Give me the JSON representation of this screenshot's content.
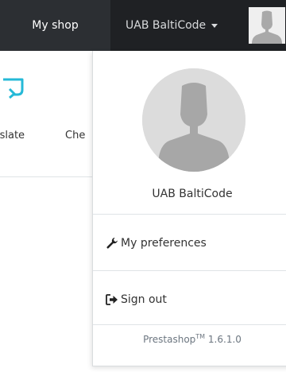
{
  "header": {
    "shop_label": "My shop",
    "user_label": "UAB BaltiCode"
  },
  "page": {
    "tab_translate": "ıslate",
    "tab_check": "Che"
  },
  "dropdown": {
    "name": "UAB BaltiCode",
    "preferences_label": "My preferences",
    "signout_label": "Sign out",
    "footer_brand": "Prestashop",
    "footer_tm": "TM",
    "footer_version": "1.6.1.0"
  },
  "colors": {
    "topbar": "#2c2f33",
    "user_nav": "#1f2124",
    "accent_icon": "#25b9d7"
  },
  "icons": {
    "page_icon": "translate-icon",
    "preferences": "wrench-icon",
    "signout": "sign-out-icon",
    "avatar": "default-user-avatar"
  }
}
